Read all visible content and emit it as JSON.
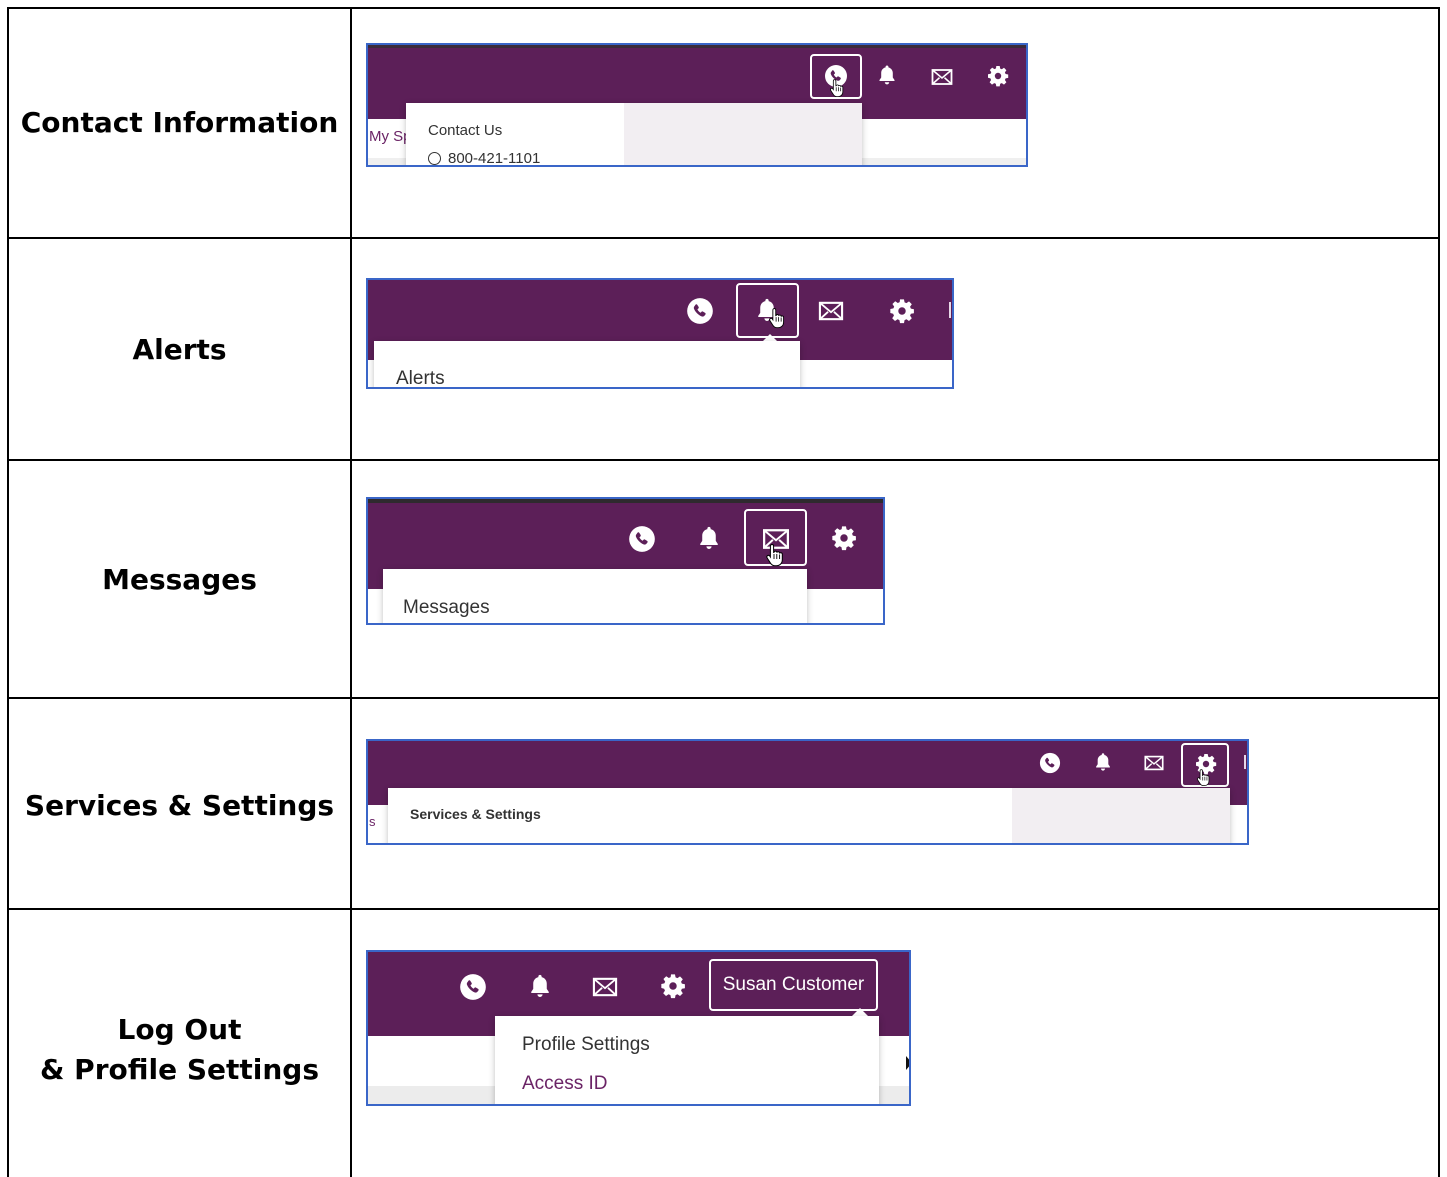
{
  "rows": [
    {
      "label": "Contact Information"
    },
    {
      "label": "Alerts"
    },
    {
      "label": "Messages"
    },
    {
      "label": "Services & Settings"
    },
    {
      "label_line1": "Log Out",
      "label_line2": "& Profile Settings"
    }
  ],
  "shot1": {
    "partial_tab": "My Sp",
    "dropdown_title": "Contact Us",
    "phone": "800-421-1101"
  },
  "shot2": {
    "dropdown_title": "Alerts"
  },
  "shot3": {
    "dropdown_title": "Messages"
  },
  "shot4": {
    "partial_tab": "s",
    "dropdown_title": "Services & Settings"
  },
  "shot5": {
    "user_button": "Susan Customer",
    "menu_item_1": "Profile Settings",
    "menu_item_2": "Access ID"
  },
  "icons": [
    "phone-icon",
    "bell-icon",
    "envelope-icon",
    "gear-icon",
    "pointer-hand-icon"
  ],
  "colors": {
    "header_purple": "#5c1f58",
    "link_purple": "#6b2466",
    "frame_blue": "#3a66c8"
  }
}
